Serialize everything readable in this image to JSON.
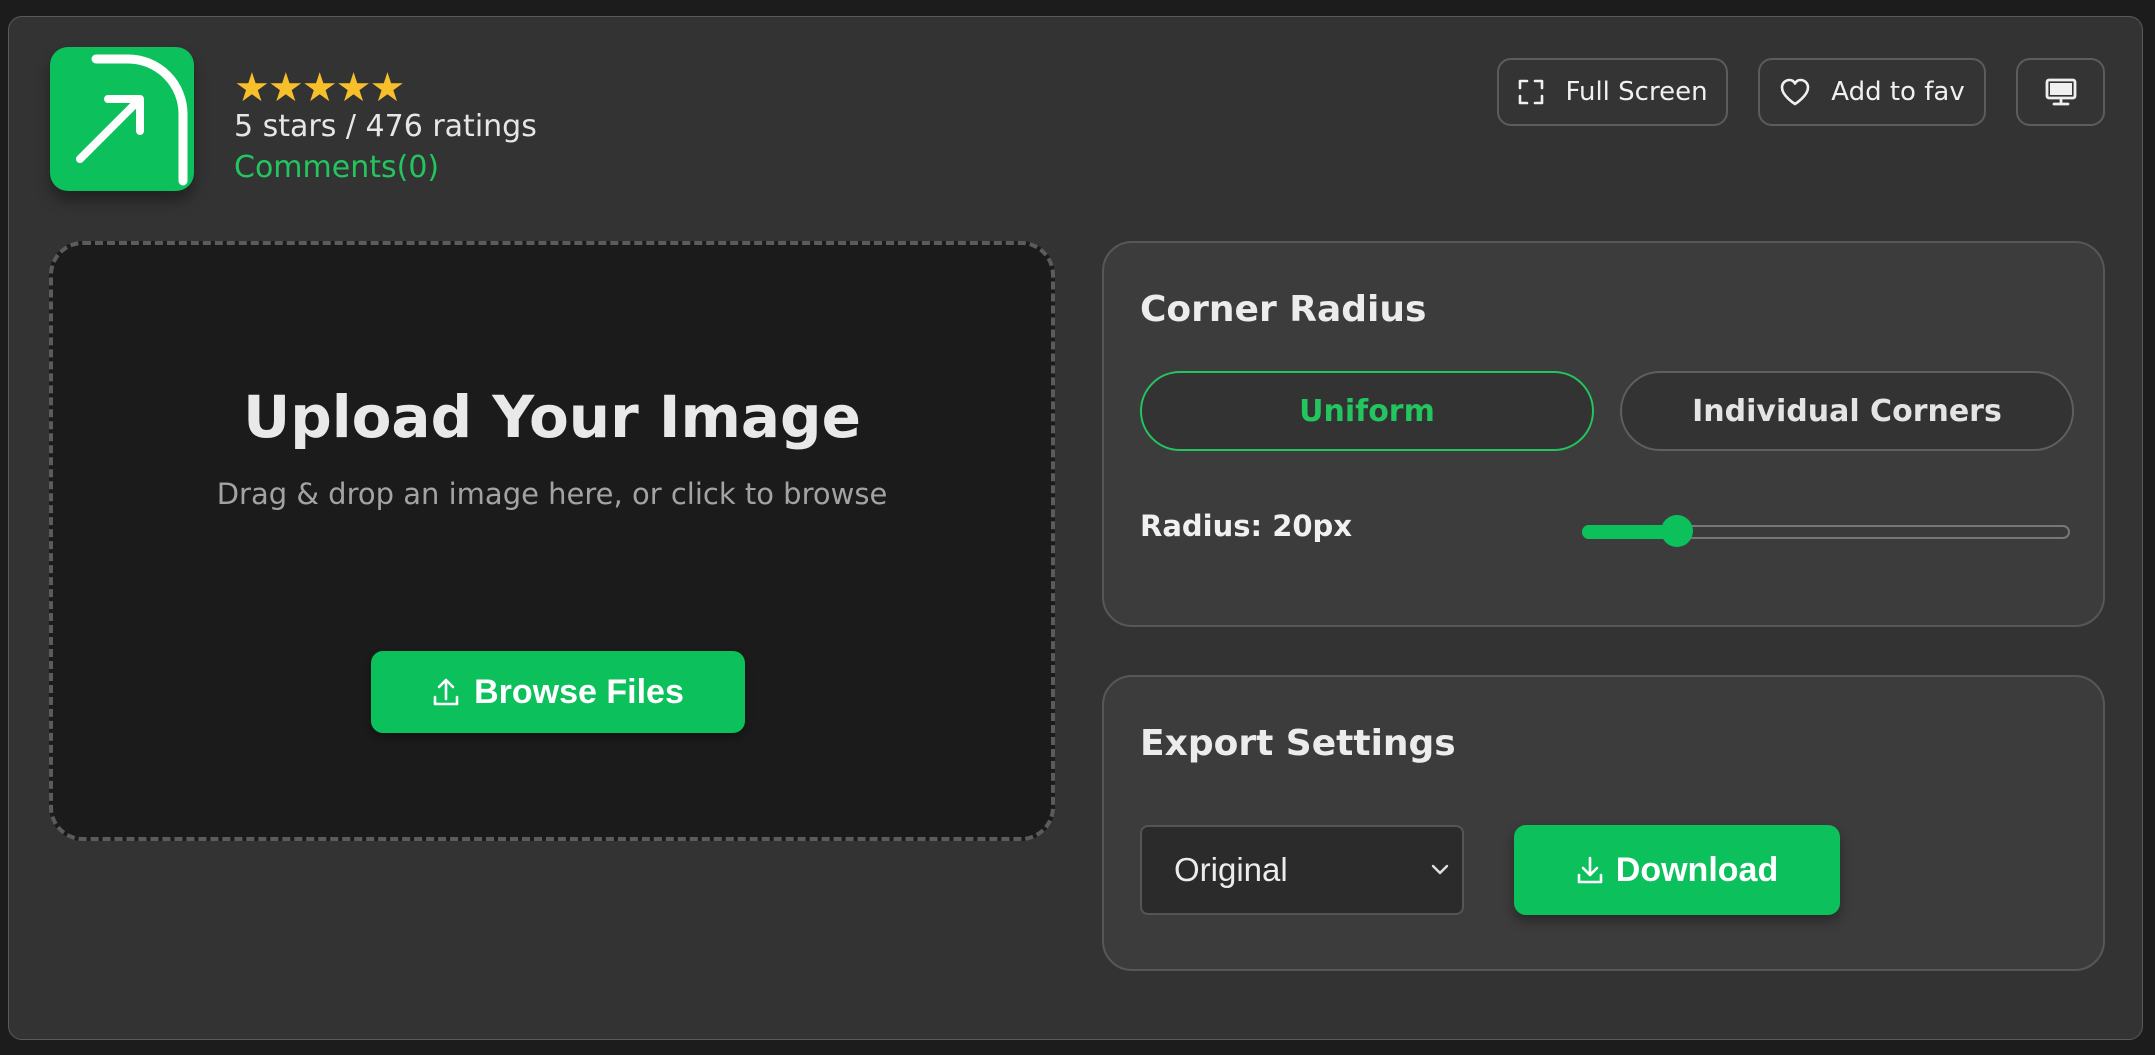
{
  "header": {
    "stars": "★★★★★",
    "rating_value": 5,
    "rating_max": 5,
    "rating_text": "5 stars / 476 ratings",
    "comments_link": "Comments(0)",
    "logo_icon": "rounded-corner-arrow-icon",
    "buttons": {
      "full_screen": "Full Screen",
      "add_to_fav": "Add to fav",
      "desktop_icon": "monitor-icon"
    }
  },
  "upload": {
    "title": "Upload Your Image",
    "subtitle": "Drag & drop an image here, or click to browse",
    "browse_label": "Browse Files"
  },
  "corner_radius": {
    "title": "Corner Radius",
    "modes": [
      "Uniform",
      "Individual Corners"
    ],
    "active_mode": "Uniform",
    "radius_label": "Radius: 20px",
    "slider_fraction": 0.19
  },
  "export": {
    "title": "Export Settings",
    "format_selected": "Original",
    "download_label": "Download"
  },
  "colors": {
    "accent": "#0cc05c",
    "accent_text": "#22c55e",
    "star": "#f7c02b",
    "background": "#333333"
  }
}
